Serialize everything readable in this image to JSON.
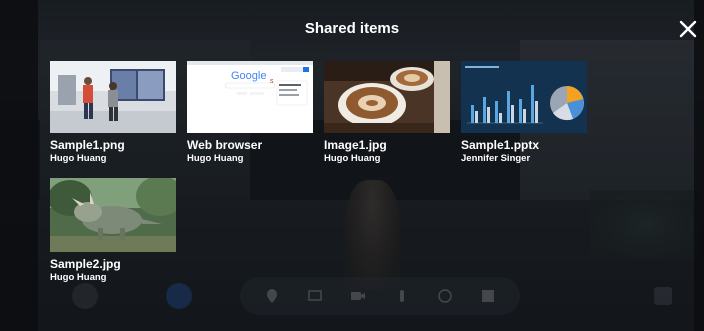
{
  "header": {
    "title": "Shared items",
    "close_icon": "close-icon"
  },
  "items": [
    {
      "name": "Sample1.png",
      "owner": "Hugo Huang",
      "thumb": "vr-room-people"
    },
    {
      "name": "Web browser",
      "owner": "Hugo Huang",
      "thumb": "search-page"
    },
    {
      "name": "Image1.jpg",
      "owner": "Hugo Huang",
      "thumb": "coffee-cups"
    },
    {
      "name": "Sample1.pptx",
      "owner": "Jennifer Singer",
      "thumb": "chart-slide"
    },
    {
      "name": "Sample2.jpg",
      "owner": "Hugo Huang",
      "thumb": "dinosaur"
    }
  ],
  "browser_thumb": {
    "logo_text": "Google"
  },
  "toolbar": {
    "icons": [
      "avatar-icon",
      "microphone-icon",
      "location-icon",
      "share-screen-icon",
      "camera-icon",
      "hand-icon",
      "chat-icon",
      "grid-icon",
      "fullscreen-icon"
    ]
  },
  "colors": {
    "accent": "#2f6fd8",
    "text": "#ffffff",
    "overlay": "#0a0c10"
  }
}
